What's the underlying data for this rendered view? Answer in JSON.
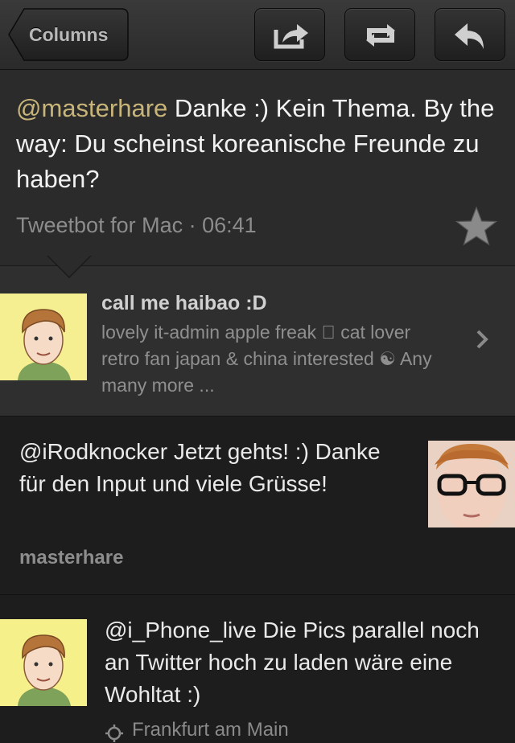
{
  "nav": {
    "back_label": "Columns",
    "actions": [
      {
        "name": "share",
        "icon": "share-icon"
      },
      {
        "name": "retweet",
        "icon": "retweet-icon"
      },
      {
        "name": "reply",
        "icon": "reply-icon"
      }
    ]
  },
  "tweet": {
    "mention": "@masterhare",
    "text": " Danke :) Kein Thema. By the way: Du scheinst koreanische Freunde zu haben?",
    "meta": "Tweetbot for Mac · 06:41",
    "favorite_icon": "star-icon"
  },
  "author": {
    "name": "call me haibao :D",
    "bio": "lovely it-admin apple freak  cat lover retro fan japan & china interested ☯ Any many more ...",
    "chevron_icon": "chevron-right-icon"
  },
  "timeline": [
    {
      "text": "@iRodknocker Jetzt gehts! :) Danke für den Input und viele Grüsse!",
      "user": "masterhare"
    },
    {
      "text": "@i_Phone_live Die Pics parallel noch an Twitter hoch zu laden wäre eine Wohltat :)",
      "location": "Frankfurt am Main",
      "location_icon": "location-icon"
    }
  ],
  "colors": {
    "mention": "#c8b57a",
    "background": "#1b1b1b",
    "detail_bg": "#2b2b2b"
  }
}
